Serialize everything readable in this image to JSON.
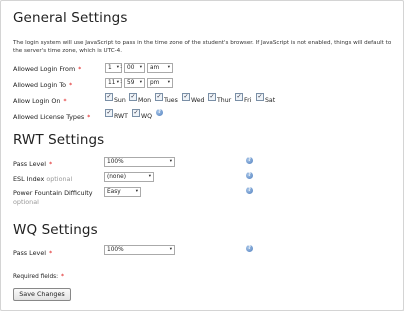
{
  "general": {
    "heading": "General Settings",
    "note": "The login system will use JavaScript to pass in the time zone of the student's browser. If JavaScript is not enabled, things will default to the server's time zone, which is UTC-4.",
    "login_from": {
      "label": "Allowed Login From",
      "hour": "1",
      "minute": "00",
      "ampm": "am"
    },
    "login_to": {
      "label": "Allowed Login To",
      "hour": "11",
      "minute": "59",
      "ampm": "pm"
    },
    "login_on": {
      "label": "Allow Login On",
      "days": [
        "Sun",
        "Mon",
        "Tues",
        "Wed",
        "Thur",
        "Fri",
        "Sat"
      ]
    },
    "license": {
      "label": "Allowed License Types",
      "types": [
        "RWT",
        "WQ"
      ]
    }
  },
  "rwt": {
    "heading": "RWT Settings",
    "pass_level": {
      "label": "Pass Level",
      "value": "100%"
    },
    "esl_index": {
      "label": "ESL Index",
      "optional": "optional",
      "value": "(none)"
    },
    "power_fountain": {
      "label": "Power Fountain Difficulty",
      "optional": "optional",
      "value": "Easy"
    }
  },
  "wq": {
    "heading": "WQ Settings",
    "pass_level": {
      "label": "Pass Level",
      "value": "100%"
    }
  },
  "required_note": "Required fields:",
  "required_mark": "*",
  "save_label": "Save Changes",
  "help_glyph": "?",
  "check_glyph": "✓",
  "caret_glyph": "▾",
  "time_sep": ":",
  "colors": {
    "required": "#dd1111",
    "help": "#4f7fbf",
    "optional": "#999999"
  }
}
